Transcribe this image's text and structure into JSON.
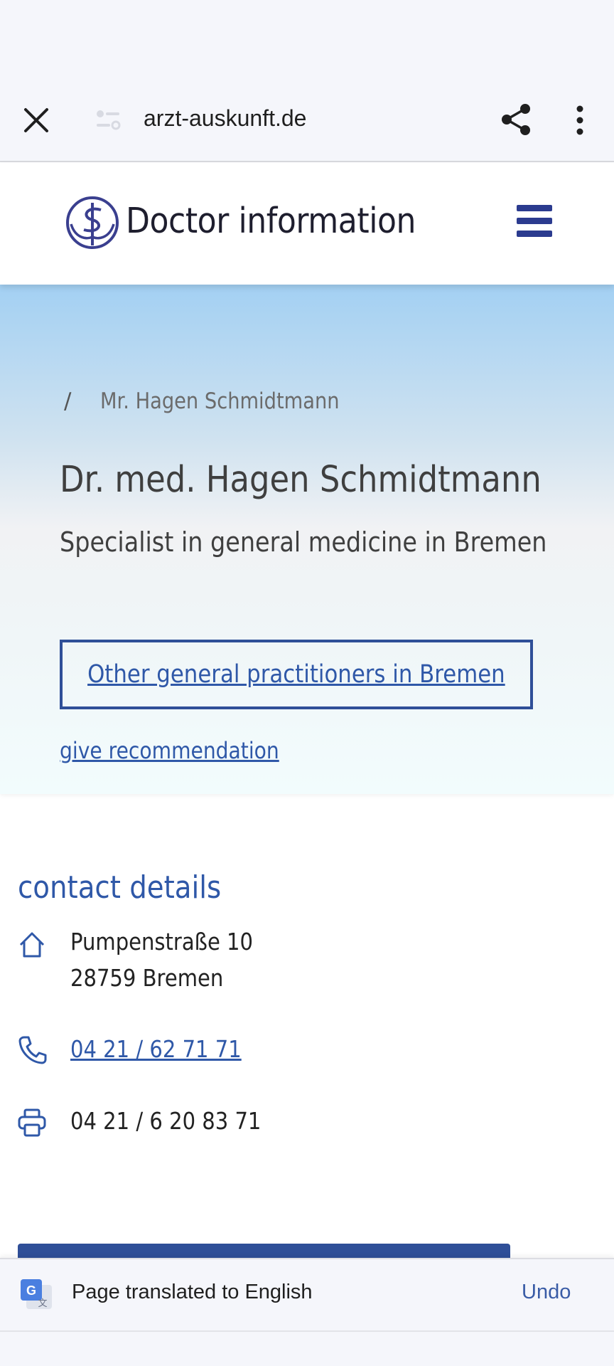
{
  "browser": {
    "url": "arzt-auskunft.de"
  },
  "site": {
    "brand": "Doctor information"
  },
  "breadcrumb": {
    "separator": "/",
    "current": "Mr. Hagen Schmidtmann"
  },
  "profile": {
    "name": "Dr. med. Hagen Schmidtmann",
    "specialty": "Specialist in general medicine in Bremen",
    "other_button": "Other general practitioners in Bremen",
    "recommend_link": "give recommendation"
  },
  "contact": {
    "heading": "contact details",
    "street": "Pumpenstraße 10",
    "city": "28759 Bremen",
    "phone": "04 21 / 62 71 71",
    "fax": "04 21 / 6 20 83 71"
  },
  "translate": {
    "message": "Page translated to English",
    "undo": "Undo"
  },
  "colors": {
    "accent": "#2f58a8",
    "brand_dark": "#2b3b8f"
  }
}
